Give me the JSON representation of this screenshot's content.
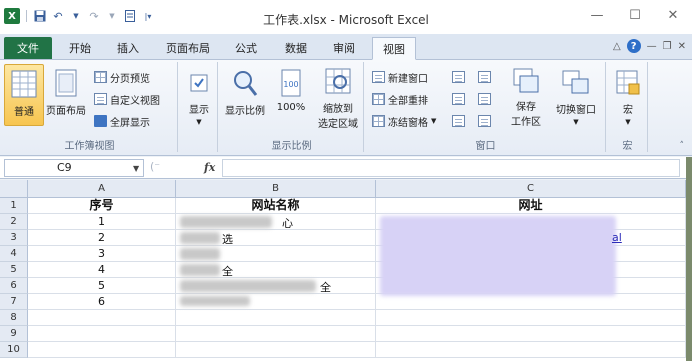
{
  "window": {
    "title": "工作表.xlsx - Microsoft Excel",
    "minimize": "—",
    "maximize": "☐",
    "close": "✕"
  },
  "quick_access": {
    "logo": "X"
  },
  "tabs": [
    {
      "label": "文件"
    },
    {
      "label": "开始"
    },
    {
      "label": "插入"
    },
    {
      "label": "页面布局"
    },
    {
      "label": "公式"
    },
    {
      "label": "数据"
    },
    {
      "label": "审阅"
    },
    {
      "label": "视图"
    }
  ],
  "ribbon": {
    "workbook_views": {
      "label": "工作簿视图",
      "normal": "普通",
      "page_layout": "页面布局",
      "page_break": "分页预览",
      "custom_views": "自定义视图",
      "full_screen": "全屏显示"
    },
    "show": {
      "label": "显示"
    },
    "zoom": {
      "label": "显示比例",
      "zoom": "显示比例",
      "hundred": "100%",
      "zoom_selection_line1": "缩放到",
      "zoom_selection_line2": "选定区域"
    },
    "window": {
      "label": "窗口",
      "new_window": "新建窗口",
      "arrange_all": "全部重排",
      "freeze_panes": "冻结窗格",
      "save_workspace_line1": "保存",
      "save_workspace_line2": "工作区",
      "switch_windows": "切换窗口"
    },
    "macros": {
      "label": "宏",
      "macros": "宏"
    }
  },
  "formula_bar": {
    "name_box": "C9",
    "fx": "fx"
  },
  "sheet": {
    "columns": [
      "A",
      "B",
      "C"
    ],
    "rows": [
      "1",
      "2",
      "3",
      "4",
      "5",
      "6",
      "7",
      "8",
      "9",
      "10"
    ],
    "headers": {
      "a": "序号",
      "b": "网站名称",
      "c": "网址"
    },
    "col_a": [
      "1",
      "2",
      "3",
      "4",
      "5",
      "6"
    ],
    "col_b": [
      "心",
      "选",
      "",
      "全",
      "全",
      ""
    ],
    "col_c": [
      "",
      "al",
      "",
      "",
      "",
      ""
    ]
  },
  "colors": {
    "file_tab": "#217346",
    "selected_button": "#f7c550",
    "link_blur": "#c9c3f0"
  }
}
